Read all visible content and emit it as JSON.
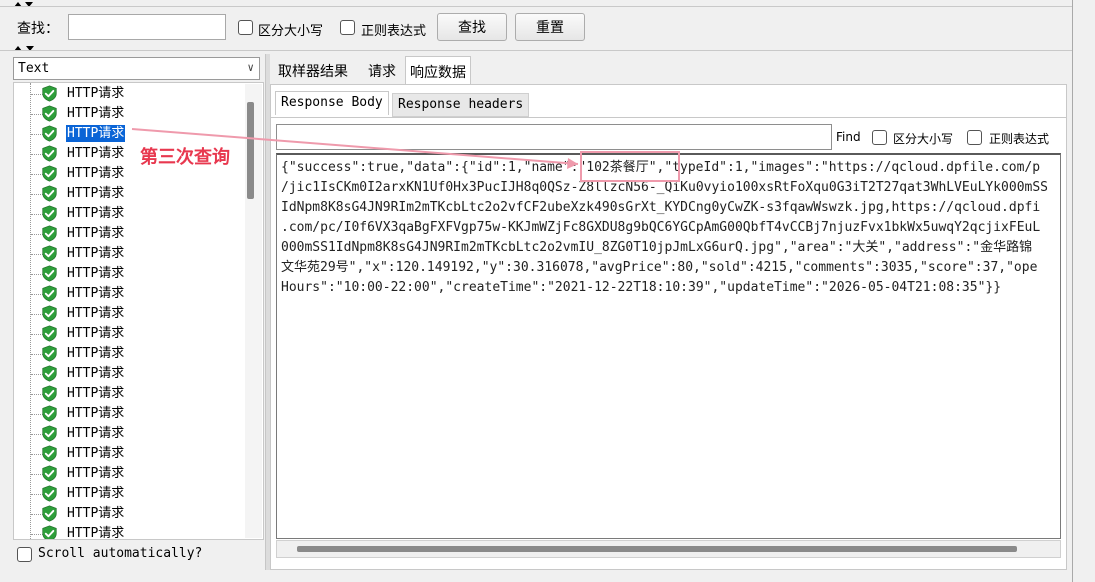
{
  "search": {
    "label": "查找：",
    "input_value": "",
    "case_label": "区分大小写",
    "regex_label": "正则表达式",
    "find_button": "查找",
    "reset_button": "重置"
  },
  "left": {
    "renderer": "Text",
    "tree_item_label": "HTTP请求",
    "tree_items": [
      "HTTP请求",
      "HTTP请求",
      "HTTP请求",
      "HTTP请求",
      "HTTP请求",
      "HTTP请求",
      "HTTP请求",
      "HTTP请求",
      "HTTP请求",
      "HTTP请求",
      "HTTP请求",
      "HTTP请求",
      "HTTP请求",
      "HTTP请求",
      "HTTP请求",
      "HTTP请求",
      "HTTP请求",
      "HTTP请求",
      "HTTP请求",
      "HTTP请求",
      "HTTP请求",
      "HTTP请求",
      "HTTP请求"
    ],
    "scroll_auto_label": "Scroll automatically?"
  },
  "tabs": {
    "sampler_result": "取样器结果",
    "request": "请求",
    "response_data": "响应数据"
  },
  "sub_tabs": {
    "body": "Response Body",
    "headers": "Response headers"
  },
  "find_bar": {
    "find_label": "Find",
    "case_label": "区分大小写",
    "regex_label": "正则表达式"
  },
  "response_lines": [
    "{\"success\":true,\"data\":{\"id\":1,\"name\":\"102茶餐厅\",\"typeId\":1,\"images\":\"https://qcloud.dpfile.com/p",
    "/jic1IsCKm0I2arxKN1Uf0Hx3PucIJH8q0QSz-Z8llzcN56-_QiKu0vyio100xsRtFoXqu0G3iT2T27qat3WhLVEuLYk000mSS",
    "IdNpm8K8sG4JN9RIm2mTKcbLtc2o2vfCF2ubeXzk490sGrXt_KYDCng0yCwZK-s3fqawWswzk.jpg,https://qcloud.dpfi",
    ".com/pc/I0f6VX3qaBgFXFVgp75w-KKJmWZjFc8GXDU8g9bQC6YGCpAmG00QbfT4vCCBj7njuzFvx1bkWx5uwqY2qcjixFEuL",
    "000mSS1IdNpm8K8sG4JN9RIm2mTKcbLtc2o2vmIU_8ZG0T10jpJmLxG6urQ.jpg\",\"area\":\"大关\",\"address\":\"金华路锦",
    "文华苑29号\",\"x\":120.149192,\"y\":30.316078,\"avgPrice\":80,\"sold\":4215,\"comments\":3035,\"score\":37,\"ope",
    "Hours\":\"10:00-22:00\",\"createTime\":\"2021-12-22T18:10:39\",\"updateTime\":\"2026-05-04T21:08:35\"}}"
  ],
  "annotation": {
    "text": "第三次查询",
    "color": "#e8384f"
  },
  "colors": {
    "selection": "#0a64d6",
    "shield_green": "#2e9e3a"
  }
}
